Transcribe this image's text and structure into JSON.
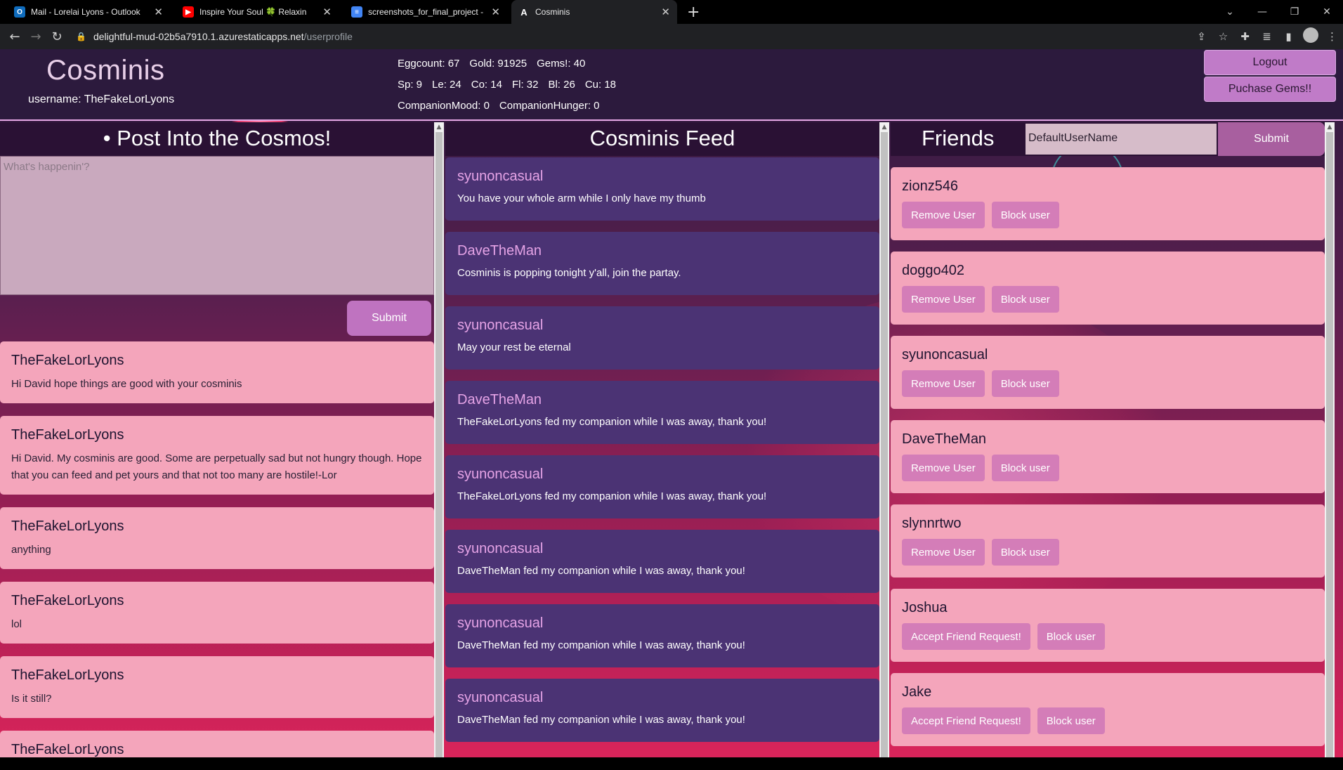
{
  "browser": {
    "tabs": [
      {
        "title": "Mail - Lorelai Lyons - Outlook",
        "icon": "outlook-icon",
        "color": "#0f6cbd"
      },
      {
        "title": "Inspire Your Soul 🍀 Relaxin",
        "icon": "youtube-icon",
        "color": "#ff0000"
      },
      {
        "title": "screenshots_for_final_project - G",
        "icon": "docs-icon",
        "color": "#4285f4"
      },
      {
        "title": "Cosminis",
        "icon": "app-icon",
        "color": "#202124"
      }
    ],
    "url_host": "delightful-mud-02b5a7910.1.azurestaticapps.net",
    "url_path": "/userprofile"
  },
  "header": {
    "logo": "Cosminis",
    "username": "username: TheFakeLorLyons",
    "stats_row1": [
      "Eggcount: 67",
      "Gold: 91925",
      "Gems!: 40"
    ],
    "stats_row2": [
      "Sp: 9",
      "Le: 24",
      "Co: 14",
      "Fl: 32",
      "Bl: 26",
      "Cu: 18"
    ],
    "stats_row3": [
      "CompanionMood: 0",
      "CompanionHunger: 0"
    ],
    "logout": "Logout",
    "purchase": "Puchase Gems!!"
  },
  "post": {
    "title": "• Post Into the Cosmos!",
    "placeholder": "What's happenin'?",
    "submit": "Submit",
    "posts": [
      {
        "user": "TheFakeLorLyons",
        "text": "Hi David hope things are good with your cosminis"
      },
      {
        "user": "TheFakeLorLyons",
        "text": "Hi David. My cosminis are good. Some are perpetually sad but not hungry though. Hope that you can feed and pet yours and that not too many are hostile!-Lor"
      },
      {
        "user": "TheFakeLorLyons",
        "text": "anything"
      },
      {
        "user": "TheFakeLorLyons",
        "text": "lol"
      },
      {
        "user": "TheFakeLorLyons",
        "text": "Is it still?"
      },
      {
        "user": "TheFakeLorLyons",
        "text": ""
      }
    ]
  },
  "feed": {
    "title": "Cosminis Feed",
    "items": [
      {
        "user": "syunoncasual",
        "text": "You have your whole arm while I only have my thumb"
      },
      {
        "user": "DaveTheMan",
        "text": "Cosminis is popping tonight y'all, join the partay."
      },
      {
        "user": "syunoncasual",
        "text": "May your rest be eternal"
      },
      {
        "user": "DaveTheMan",
        "text": "TheFakeLorLyons fed my companion while I was away, thank you!"
      },
      {
        "user": "syunoncasual",
        "text": "TheFakeLorLyons fed my companion while I was away, thank you!"
      },
      {
        "user": "syunoncasual",
        "text": "DaveTheMan fed my companion while I was away, thank you!"
      },
      {
        "user": "syunoncasual",
        "text": "DaveTheMan fed my companion while I was away, thank you!"
      },
      {
        "user": "syunoncasual",
        "text": "DaveTheMan fed my companion while I was away, thank you!"
      }
    ]
  },
  "friends": {
    "title": "Friends",
    "input_value": "DefaultUserName",
    "submit": "Submit",
    "list": [
      {
        "user": "zionz546",
        "primary": "Remove User",
        "secondary": "Block user"
      },
      {
        "user": "doggo402",
        "primary": "Remove User",
        "secondary": "Block user"
      },
      {
        "user": "syunoncasual",
        "primary": "Remove User",
        "secondary": "Block user"
      },
      {
        "user": "DaveTheMan",
        "primary": "Remove User",
        "secondary": "Block user"
      },
      {
        "user": "slynnrtwo",
        "primary": "Remove User",
        "secondary": "Block user"
      },
      {
        "user": "Joshua",
        "primary": "Accept Friend Request!",
        "secondary": "Block user"
      },
      {
        "user": "Jake",
        "primary": "Accept Friend Request!",
        "secondary": "Block user"
      }
    ]
  }
}
